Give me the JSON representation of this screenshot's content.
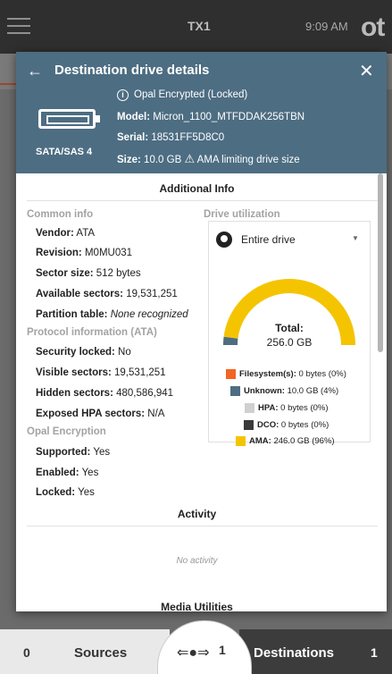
{
  "appbar": {
    "title": "TX1",
    "time": "9:09 AM",
    "logo": "ot"
  },
  "modal": {
    "title": "Destination drive details",
    "status": "Opal Encrypted (Locked)",
    "interface": "SATA/SAS 4",
    "model_label": "Model:",
    "model": "Micron_1100_MTFDDAK256TBN",
    "serial_label": "Serial:",
    "serial": "18531FF5D8C0",
    "size_label": "Size:",
    "size": "10.0 GB",
    "size_warning": "AMA limiting drive size"
  },
  "additional_info": {
    "title": "Additional Info",
    "common_info_label": "Common info",
    "common": [
      {
        "label": "Vendor:",
        "value": "ATA"
      },
      {
        "label": "Revision:",
        "value": "M0MU031"
      },
      {
        "label": "Sector size:",
        "value": "512 bytes"
      },
      {
        "label": "Available sectors:",
        "value": "19,531,251"
      },
      {
        "label": "Partition table:",
        "value": "None recognized"
      }
    ],
    "protocol_label": "Protocol information (ATA)",
    "protocol": [
      {
        "label": "Security locked:",
        "value": "No"
      },
      {
        "label": "Visible sectors:",
        "value": "19,531,251"
      },
      {
        "label": "Hidden sectors:",
        "value": "480,586,941"
      },
      {
        "label": "Exposed HPA sectors:",
        "value": "N/A"
      }
    ],
    "opal_label": "Opal Encryption",
    "opal": [
      {
        "label": "Supported:",
        "value": "Yes"
      },
      {
        "label": "Enabled:",
        "value": "Yes"
      },
      {
        "label": "Locked:",
        "value": "Yes"
      }
    ]
  },
  "drive_utilization": {
    "label": "Drive utilization",
    "selected": "Entire drive",
    "total_label": "Total:",
    "total": "256.0 GB",
    "legend": [
      {
        "label": "Filesystem(s):",
        "value": "0 bytes (0%)",
        "color": "#f26522",
        "fraction": 0.0
      },
      {
        "label": "Unknown:",
        "value": "10.0 GB (4%)",
        "color": "#4d6d82",
        "fraction": 0.04
      },
      {
        "label": "HPA:",
        "value": "0 bytes (0%)",
        "color": "#d0d0d0",
        "fraction": 0.0
      },
      {
        "label": "DCO:",
        "value": "0 bytes (0%)",
        "color": "#3a3a3a",
        "fraction": 0.0
      },
      {
        "label": "AMA:",
        "value": "246.0 GB (96%)",
        "color": "#f5c400",
        "fraction": 0.96
      }
    ]
  },
  "activity": {
    "title": "Activity",
    "empty": "No activity"
  },
  "media_utilities": {
    "title": "Media Utilities"
  },
  "bottombar": {
    "sources_count": "0",
    "sources_label": "Sources",
    "usb_count": "1",
    "destinations_label": "Destinations",
    "destinations_count": "1"
  }
}
